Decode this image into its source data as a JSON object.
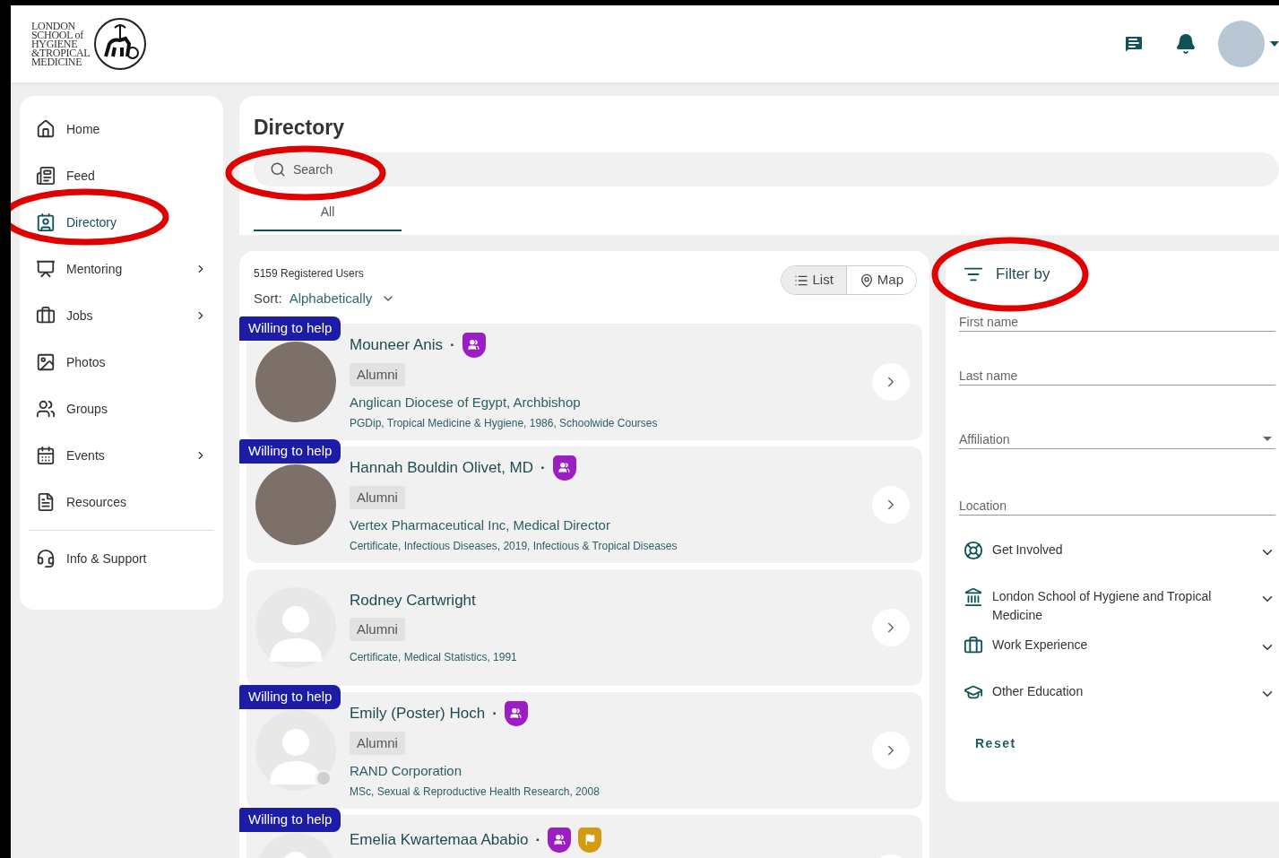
{
  "logo": {
    "lines": [
      "LONDON",
      "SCHOOL of",
      "HYGIENE",
      "&TROPICAL",
      "MEDICINE"
    ]
  },
  "sidebar": {
    "items": [
      {
        "label": "Home",
        "chevron": false,
        "selected": false
      },
      {
        "label": "Feed",
        "chevron": false,
        "selected": false
      },
      {
        "label": "Directory",
        "chevron": false,
        "selected": true
      },
      {
        "label": "Mentoring",
        "chevron": true,
        "selected": false
      },
      {
        "label": "Jobs",
        "chevron": true,
        "selected": false
      },
      {
        "label": "Photos",
        "chevron": false,
        "selected": false
      },
      {
        "label": "Groups",
        "chevron": false,
        "selected": false
      },
      {
        "label": "Events",
        "chevron": true,
        "selected": false
      },
      {
        "label": "Resources",
        "chevron": false,
        "selected": false
      }
    ],
    "footer_items": [
      {
        "label": "Info & Support",
        "chevron": false,
        "selected": false
      }
    ]
  },
  "directory": {
    "title": "Directory",
    "search": {
      "placeholder": "Search"
    },
    "tabs": [
      {
        "label": "All",
        "selected": true
      }
    ]
  },
  "results": {
    "count": "5159 Registered Users",
    "sort_label": "Sort:",
    "sort_value": "Alphabetically",
    "view_toggle": [
      {
        "label": "List",
        "selected": true
      },
      {
        "label": "Map",
        "selected": false
      }
    ],
    "people": [
      {
        "willing": true,
        "tag": "Willing to help",
        "has_photo": true,
        "status_dot": false,
        "name": "Mouneer Anis",
        "separator": "·",
        "badges": [
          {
            "kind": "group"
          }
        ],
        "chip": "Alumni",
        "line1": "Anglican Diocese of Egypt, Archbishop",
        "line2": "PGDip, Tropical Medicine & Hygiene, 1986, Schoolwide Courses"
      },
      {
        "willing": true,
        "tag": "Willing to help",
        "has_photo": true,
        "status_dot": false,
        "name": "Hannah Bouldin Olivet, MD",
        "separator": "·",
        "badges": [
          {
            "kind": "group"
          }
        ],
        "chip": "Alumni",
        "line1": "Vertex Pharmaceutical Inc, Medical Director",
        "line2": "Certificate, Infectious Diseases, 2019, Infectious & Tropical Diseases"
      },
      {
        "willing": false,
        "has_photo": false,
        "status_dot": false,
        "name": "Rodney Cartwright",
        "chip": "Alumni",
        "line2": "Certificate, Medical Statistics, 1991"
      },
      {
        "willing": true,
        "tag": "Willing to help",
        "has_photo": false,
        "status_dot": true,
        "name": "Emily (Poster) Hoch",
        "separator": "·",
        "badges": [
          {
            "kind": "group"
          }
        ],
        "chip": "Alumni",
        "line1": "RAND Corporation",
        "line2": "MSc, Sexual & Reproductive Health Research, 2008"
      },
      {
        "willing": true,
        "tag": "Willing to help",
        "has_photo": false,
        "status_dot": false,
        "name": "Emelia Kwartemaa Ababio",
        "separator": "·",
        "badges": [
          {
            "kind": "group"
          },
          {
            "kind": "flag"
          }
        ]
      }
    ]
  },
  "filter": {
    "title": "Filter by",
    "fields": [
      {
        "kind": "text",
        "placeholder": "First name"
      },
      {
        "kind": "text",
        "placeholder": "Last name"
      },
      {
        "kind": "select",
        "placeholder": "Affiliation"
      },
      {
        "kind": "text",
        "placeholder": "Location"
      }
    ],
    "sections": [
      {
        "label": "Get Involved",
        "expanded": false
      },
      {
        "label": "London School of Hygiene and Tropical Medicine",
        "expanded": false
      },
      {
        "label": "Work Experience",
        "expanded": false
      },
      {
        "label": "Other Education",
        "expanded": false
      }
    ],
    "reset": "Reset"
  }
}
